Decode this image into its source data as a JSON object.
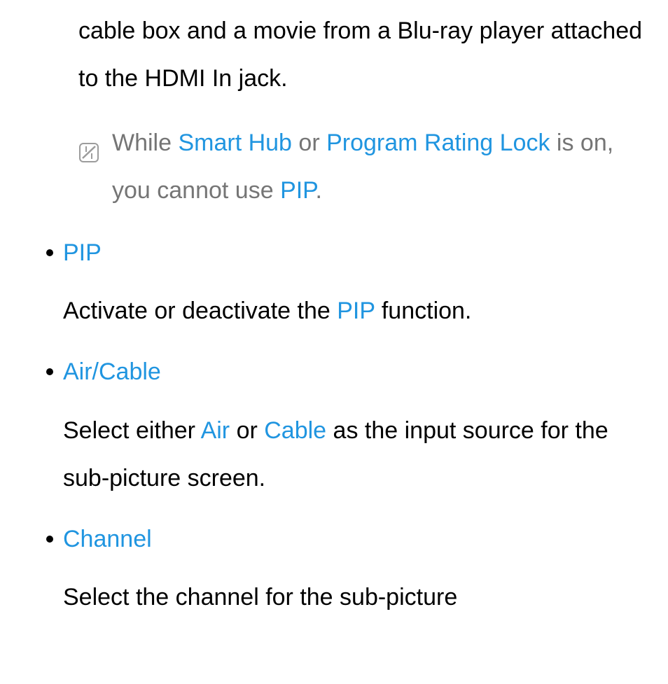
{
  "intro": "cable box and a movie from a Blu-ray player attached to the HDMI In jack.",
  "note": {
    "p1": "While ",
    "l1": "Smart Hub",
    "p2": " or ",
    "l2": "Program Rating Lock",
    "p3": " is on, you cannot use ",
    "l3": "PIP",
    "p4": "."
  },
  "items": [
    {
      "title": "PIP",
      "desc_p1": "Activate or deactivate the ",
      "desc_l1": "PIP",
      "desc_p2": " function."
    },
    {
      "title": "Air/Cable",
      "desc_p1": "Select either ",
      "desc_l1": "Air",
      "desc_p2": " or ",
      "desc_l2": "Cable",
      "desc_p3": " as the input source for the sub-picture screen."
    },
    {
      "title": "Channel",
      "desc_p1": "Select the channel for the sub-picture"
    }
  ]
}
